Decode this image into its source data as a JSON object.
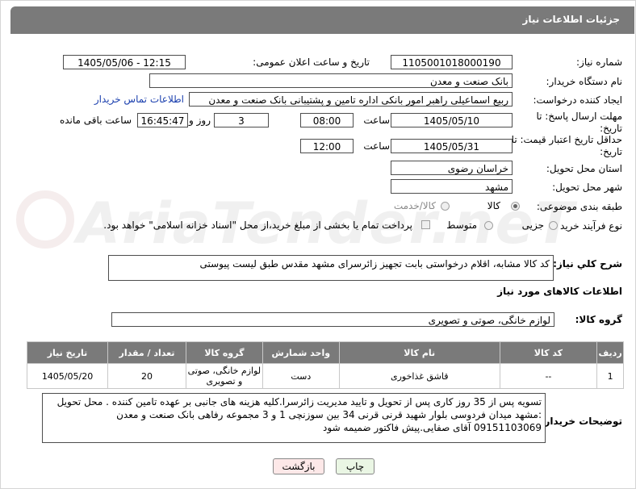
{
  "header": {
    "title": "جزئیات اطلاعات نیاز"
  },
  "watermark": "AriaTender.neT",
  "labels": {
    "need_number": "شماره نیاز:",
    "announce_datetime": "تاریخ و ساعت اعلان عمومی:",
    "buyer_org": "نام دستگاه خریدار:",
    "requester": "ایجاد کننده درخواست:",
    "reply_deadline": "مهلت ارسال پاسخ: تا تاریخ:",
    "time": "ساعت",
    "day_and": "روز و",
    "remaining": "ساعت باقی مانده",
    "price_validity": "حداقل تاریخ اعتبار قیمت: تا تاریخ:",
    "time2": "ساعت",
    "delivery_province": "استان محل تحویل:",
    "delivery_city": "شهر محل تحویل:",
    "category": "طبقه بندی موضوعی:",
    "process_type": "نوع فرآیند خرید :",
    "description": "شرح کلي نياز:",
    "goods_info": "اطلاعات کالاهای مورد نیاز",
    "goods_group": "گروه کالا:",
    "buyer_notes": "توضیحات خریدار:"
  },
  "values": {
    "need_number": "1105001018000190",
    "announce_datetime": "1405/05/06 - 12:15",
    "buyer_org": "بانک صنعت و معدن",
    "requester": "ربیع اسماعیلی راهبر امور بانکی اداره تامین و پشتیبانی بانک صنعت و معدن",
    "contact_link": "اطلاعات تماس خریدار",
    "reply_date": "1405/05/10",
    "reply_time": "08:00",
    "reply_days": "3",
    "reply_remaining": "16:45:47",
    "validity_date": "1405/05/31",
    "validity_time": "12:00",
    "province": "خراسان رضوی",
    "city": "مشهد",
    "description": "کد کالا مشابه، اقلام درخواستی بابت تجهیز زائرسرای مشهد مقدس طبق لیست پیوستی",
    "goods_group": "لوازم خانگی، صوتی و تصویری",
    "buyer_notes": "تسویه پس از 35  روز کاری پس از تحویل و  تایید مدیریت زائرسرا.کلیه هزینه های جانبی بر عهده تامین کننده . محل تحویل :مشهد میدان فردوسی بلوار شهید قرنی قرنی 34 بین سوزنچی 1 و 3 مجموعه رفاهی بانک صنعت و معدن 09151103069 آقای صفایی.پیش فاکتور ضمیمه شود"
  },
  "category_options": [
    {
      "label": "کالا",
      "selected": true
    },
    {
      "label": "کالا/خدمت",
      "selected": false
    }
  ],
  "process_options": [
    {
      "label": "جزیی",
      "selected": false
    },
    {
      "label": "متوسط",
      "selected": false
    }
  ],
  "payment_note": "پرداخت تمام یا بخشی از مبلغ خرید،از محل \"اسناد خزانه اسلامی\" خواهد بود.",
  "table": {
    "headers": [
      "ردیف",
      "کد کالا",
      "نام کالا",
      "واحد شمارش",
      "گروه کالا",
      "تعداد / مقدار",
      "تاریخ نیاز"
    ],
    "rows": [
      [
        "1",
        "--",
        "قاشق غذاخوری",
        "دست",
        "لوازم خانگی، صوتی و تصویری",
        "20",
        "1405/05/20"
      ]
    ]
  },
  "buttons": {
    "print": "چاپ",
    "back": "بازگشت"
  },
  "colors": {
    "header_bg": "#7a7a7a",
    "link": "#1a3fae",
    "back_btn_bg": "#fde8e8",
    "print_btn_bg": "#eaf6e4"
  }
}
